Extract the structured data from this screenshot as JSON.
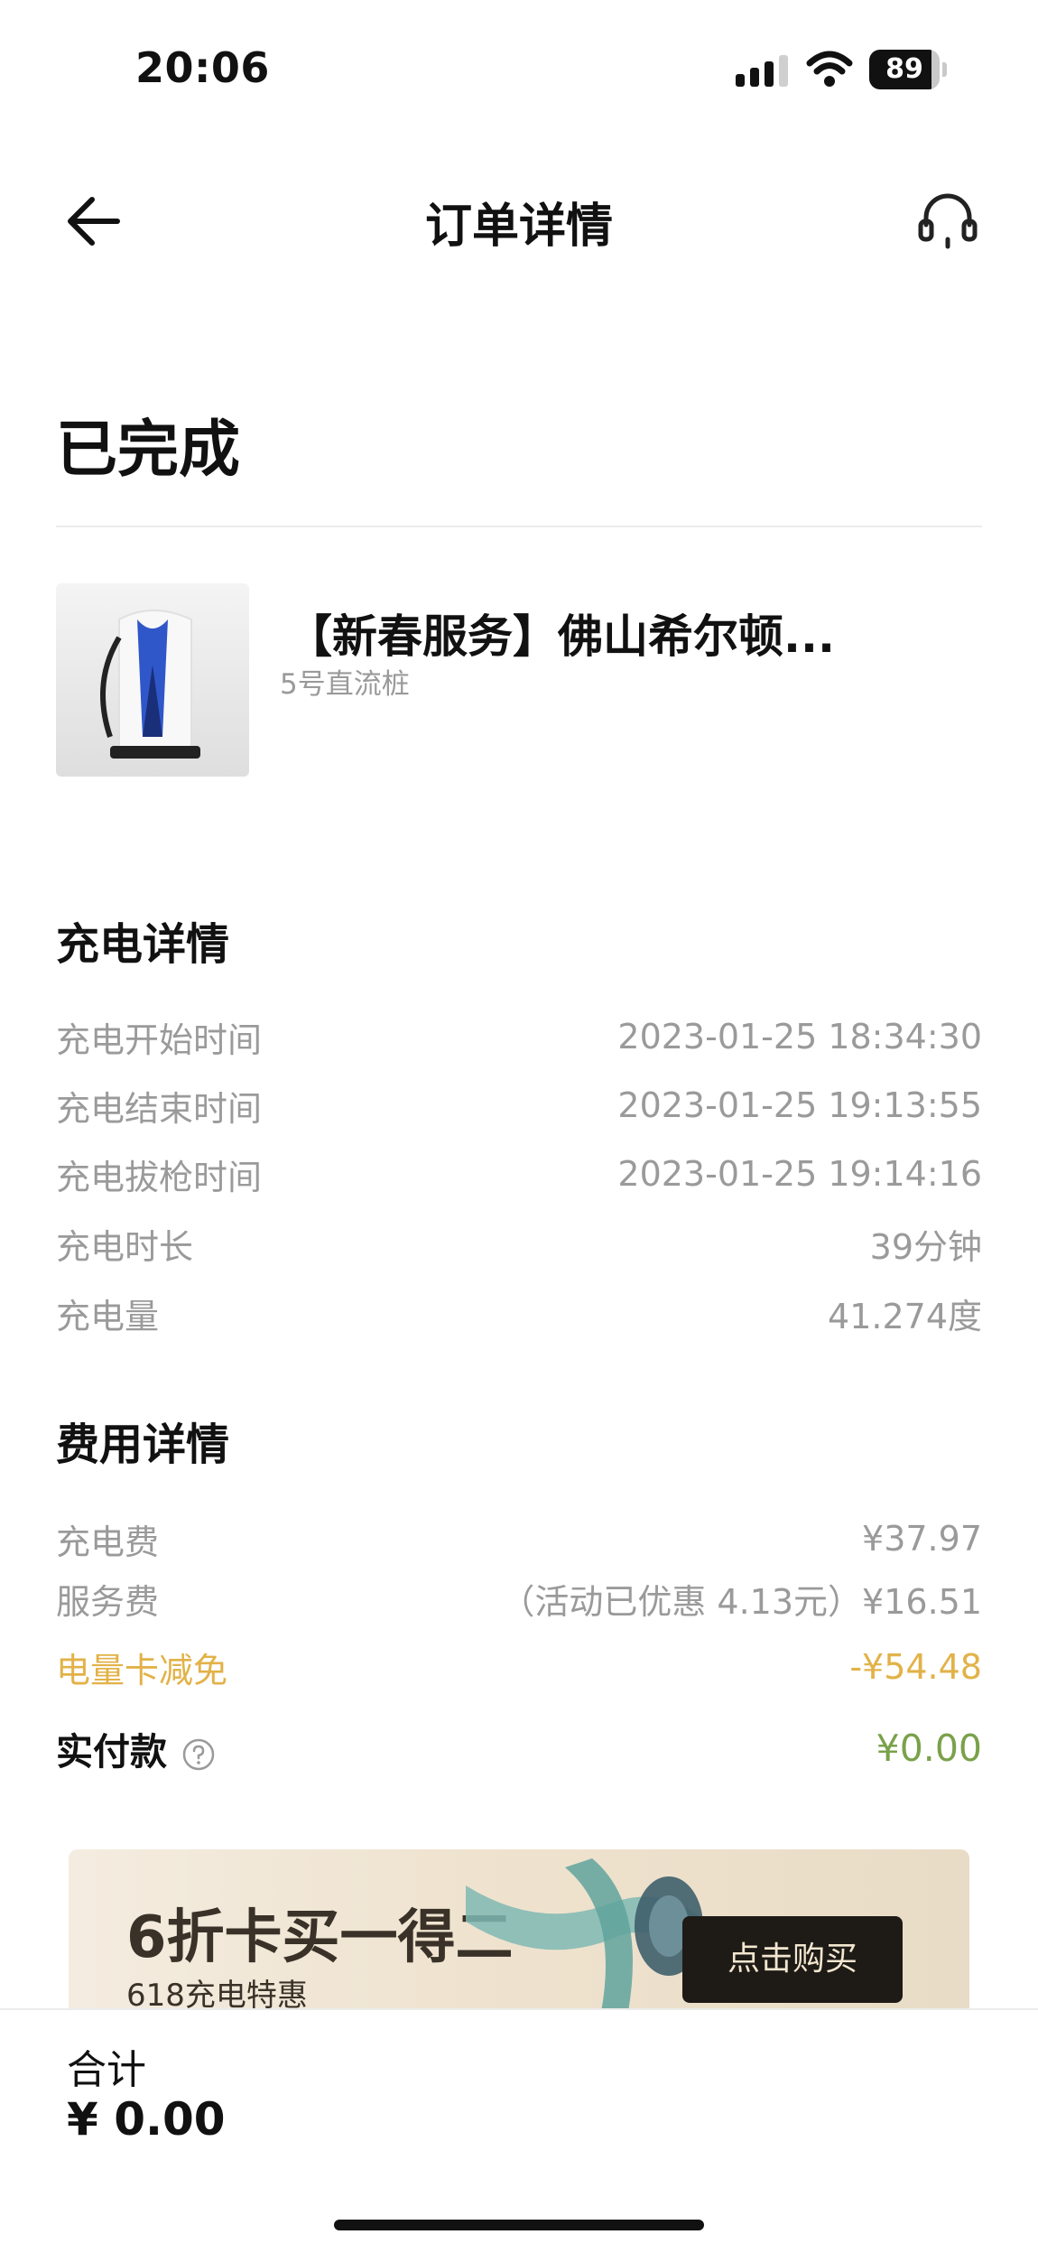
{
  "status_bar": {
    "time": "20:06",
    "battery": "89",
    "battery_level": 0.89,
    "icons": [
      "signal-icon",
      "wifi-icon",
      "battery-icon"
    ]
  },
  "nav": {
    "title": "订单详情",
    "back_icon": "arrow-left-icon",
    "support_icon": "headset-icon"
  },
  "order": {
    "status": "已完成"
  },
  "station": {
    "name": "【新春服务】佛山希尔顿...",
    "pile": "5号直流桩"
  },
  "charge_details": {
    "title": "充电详情",
    "rows": [
      {
        "label": "充电开始时间",
        "value": "2023-01-25 18:34:30"
      },
      {
        "label": "充电结束时间",
        "value": "2023-01-25 19:13:55"
      },
      {
        "label": "充电拔枪时间",
        "value": "2023-01-25 19:14:16"
      },
      {
        "label": "充电时长",
        "value": "39分钟"
      },
      {
        "label": "充电量",
        "value": "41.274度"
      }
    ]
  },
  "fee_details": {
    "title": "费用详情",
    "charge_fee": {
      "label": "充电费",
      "value": "¥37.97"
    },
    "service_fee": {
      "label": "服务费",
      "value": "（活动已优惠 4.13元）¥16.51"
    },
    "discount": {
      "label": "电量卡减免",
      "value": "-¥54.48"
    },
    "paid": {
      "label": "实付款",
      "value": "¥0.00"
    }
  },
  "banner": {
    "title": "6折卡买一得二",
    "subtitle": "618充电特惠",
    "button": "点击购买"
  },
  "footer": {
    "total_label": "合计",
    "total_value": "¥ 0.00"
  },
  "colors": {
    "discount": "#e2b248",
    "paid": "#7aa14b",
    "muted": "#9a9a9a"
  }
}
